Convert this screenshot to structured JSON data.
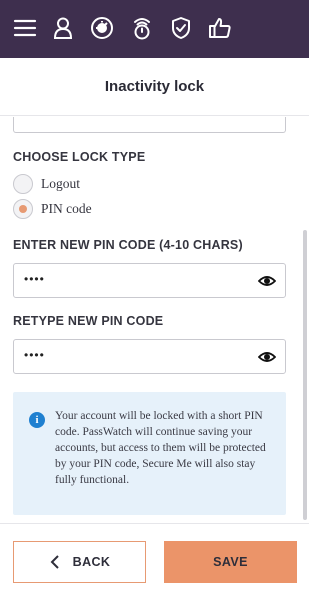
{
  "nav": {
    "icons": [
      "menu-icon",
      "user-icon",
      "dashboard-gauge-icon",
      "passwatch-timer-icon",
      "shield-icon",
      "thumbs-up-icon"
    ]
  },
  "header": {
    "title": "Inactivity lock"
  },
  "lock_type": {
    "heading": "CHOOSE LOCK TYPE",
    "options": [
      {
        "label": "Logout",
        "selected": false
      },
      {
        "label": "PIN code",
        "selected": true
      }
    ]
  },
  "new_pin": {
    "heading": "ENTER NEW PIN CODE (4-10 CHARS)",
    "value": "••••"
  },
  "retype_pin": {
    "heading": "RETYPE NEW PIN CODE",
    "value": "••••"
  },
  "info": {
    "text": "Your account will be locked with a short PIN code. PassWatch will continue saving your accounts, but access to them will be protected by your PIN code, Secure Me will also stay fully functional."
  },
  "footer": {
    "back_label": "BACK",
    "save_label": "SAVE"
  },
  "colors": {
    "topbar": "#3e2f4e",
    "accent": "#eb9469",
    "info_bg": "#e6f1fa",
    "info_icon": "#1f80d0"
  }
}
